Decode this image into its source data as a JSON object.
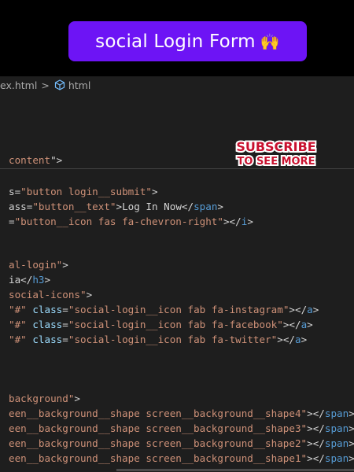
{
  "title_banner": {
    "text": "social Login Form",
    "emoji": "🙌"
  },
  "breadcrumb": {
    "file": "ex.html",
    "separator": ">",
    "node": "html"
  },
  "overlay": {
    "line1": "SUBSCRIBE",
    "line2": "TO SEE MORE"
  },
  "code_lines": [
    {
      "parts": [
        {
          "t": "content",
          "c": "str"
        },
        {
          "t": "\">",
          "c": "text"
        }
      ]
    },
    {
      "parts": [
        {
          "t": "s=",
          "c": "text"
        },
        {
          "t": "\"button login__submit\"",
          "c": "str"
        },
        {
          "t": ">",
          "c": "text"
        }
      ]
    },
    {
      "parts": [
        {
          "t": "ass=",
          "c": "text"
        },
        {
          "t": "\"button__text\"",
          "c": "str"
        },
        {
          "t": ">Log In Now</",
          "c": "text"
        },
        {
          "t": "span",
          "c": "tag"
        },
        {
          "t": ">",
          "c": "text"
        }
      ]
    },
    {
      "parts": [
        {
          "t": "=",
          "c": "text"
        },
        {
          "t": "\"button__icon fas fa-chevron-right\"",
          "c": "str"
        },
        {
          "t": "></",
          "c": "text"
        },
        {
          "t": "i",
          "c": "tag"
        },
        {
          "t": ">",
          "c": "text"
        }
      ]
    },
    {
      "parts": [
        {
          "t": "al-login\"",
          "c": "str"
        },
        {
          "t": ">",
          "c": "text"
        }
      ]
    },
    {
      "parts": [
        {
          "t": "ia</",
          "c": "text"
        },
        {
          "t": "h3",
          "c": "tag"
        },
        {
          "t": ">",
          "c": "text"
        }
      ]
    },
    {
      "parts": [
        {
          "t": "social-icons\"",
          "c": "str"
        },
        {
          "t": ">",
          "c": "text"
        }
      ]
    },
    {
      "parts": [
        {
          "t": "\"#\"",
          "c": "str"
        },
        {
          "t": " ",
          "c": "text"
        },
        {
          "t": "class",
          "c": "attr"
        },
        {
          "t": "=",
          "c": "text"
        },
        {
          "t": "\"social-login__icon fab fa-instagram\"",
          "c": "str"
        },
        {
          "t": "></",
          "c": "text"
        },
        {
          "t": "a",
          "c": "tag"
        },
        {
          "t": ">",
          "c": "text"
        }
      ]
    },
    {
      "parts": [
        {
          "t": "\"#\"",
          "c": "str"
        },
        {
          "t": " ",
          "c": "text"
        },
        {
          "t": "class",
          "c": "attr"
        },
        {
          "t": "=",
          "c": "text"
        },
        {
          "t": "\"social-login__icon fab fa-facebook\"",
          "c": "str"
        },
        {
          "t": "></",
          "c": "text"
        },
        {
          "t": "a",
          "c": "tag"
        },
        {
          "t": ">",
          "c": "text"
        }
      ]
    },
    {
      "parts": [
        {
          "t": "\"#\"",
          "c": "str"
        },
        {
          "t": " ",
          "c": "text"
        },
        {
          "t": "class",
          "c": "attr"
        },
        {
          "t": "=",
          "c": "text"
        },
        {
          "t": "\"social-login__icon fab fa-twitter\"",
          "c": "str"
        },
        {
          "t": "></",
          "c": "text"
        },
        {
          "t": "a",
          "c": "tag"
        },
        {
          "t": ">",
          "c": "text"
        }
      ]
    },
    {
      "parts": [
        {
          "t": "background\"",
          "c": "str"
        },
        {
          "t": ">",
          "c": "text"
        }
      ]
    },
    {
      "parts": [
        {
          "t": "een__background__shape screen__background__shape4\"",
          "c": "str"
        },
        {
          "t": "></",
          "c": "text"
        },
        {
          "t": "span",
          "c": "tag"
        },
        {
          "t": ">",
          "c": "text"
        }
      ]
    },
    {
      "parts": [
        {
          "t": "een__background__shape screen__background__shape3\"",
          "c": "str"
        },
        {
          "t": "></",
          "c": "text"
        },
        {
          "t": "span",
          "c": "tag"
        },
        {
          "t": ">",
          "c": "text"
        }
      ]
    },
    {
      "parts": [
        {
          "t": "een__background__shape screen__background__shape2\"",
          "c": "str"
        },
        {
          "t": "></",
          "c": "text"
        },
        {
          "t": "span",
          "c": "tag"
        },
        {
          "t": ">",
          "c": "text"
        }
      ]
    },
    {
      "parts": [
        {
          "t": "een__background__shape screen__background__shape1\"",
          "c": "str"
        },
        {
          "t": "></",
          "c": "text"
        },
        {
          "t": "span",
          "c": "tag"
        },
        {
          "t": ">",
          "c": "text"
        }
      ]
    }
  ],
  "colors": {
    "banner": "#6d14f5",
    "editor_bg": "#1e1e1e",
    "string": "#ce9178",
    "attribute": "#9cdcfe",
    "tag": "#569cd6",
    "subscribe_red": "#c8102e"
  }
}
